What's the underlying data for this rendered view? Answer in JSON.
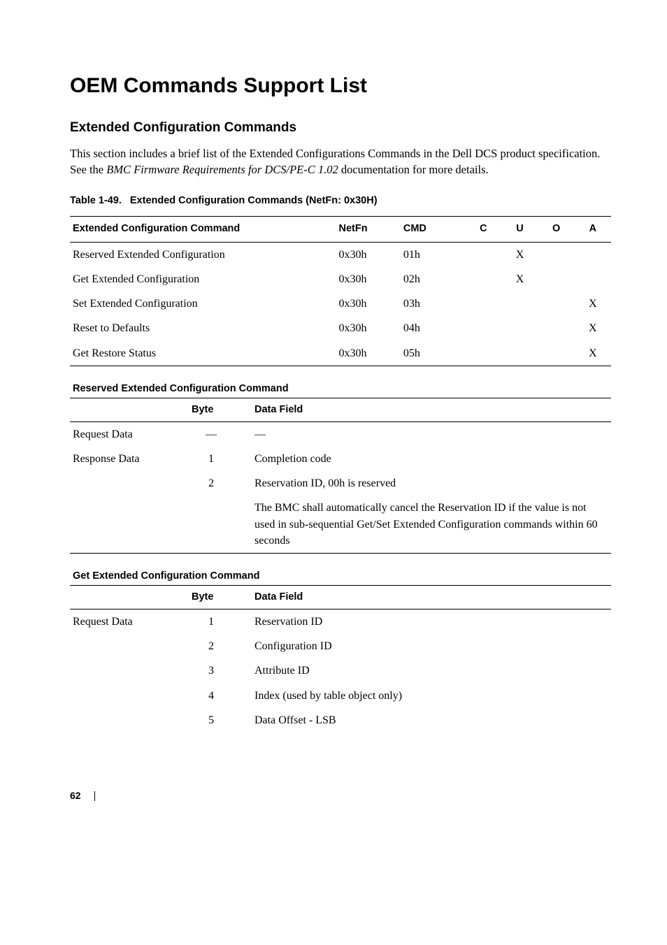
{
  "title": "OEM Commands Support List",
  "section1": {
    "heading": "Extended Configuration Commands",
    "para_part1": "This section includes a brief list of the Extended Configurations Commands in the Dell DCS product specification. See the ",
    "para_italic": "BMC Firmware Requirements for DCS/PE-C 1.02",
    "para_part2": " documentation for more details."
  },
  "table49": {
    "caption_prefix": "Table 1-49.",
    "caption_text": "Extended Configuration Commands (NetFn: 0x30H)",
    "headers": [
      "Extended Configuration Command",
      "NetFn",
      "CMD",
      "C",
      "U",
      "O",
      "A"
    ],
    "rows": [
      [
        "Reserved Extended Configuration",
        "0x30h",
        "01h",
        "",
        "X",
        "",
        ""
      ],
      [
        "Get Extended Configuration",
        "0x30h",
        "02h",
        "",
        "X",
        "",
        ""
      ],
      [
        "Set Extended Configuration",
        "0x30h",
        "03h",
        "",
        "",
        "",
        "X"
      ],
      [
        "Reset to Defaults",
        "0x30h",
        "04h",
        "",
        "",
        "",
        "X"
      ],
      [
        "Get Restore Status",
        "0x30h",
        "05h",
        "",
        "",
        "",
        "X"
      ]
    ]
  },
  "reserved": {
    "title": "Reserved Extended Configuration Command",
    "headers": [
      "",
      "Byte",
      "Data Field"
    ],
    "rows": [
      {
        "c1": "Request Data",
        "c2": "—",
        "c3": "—"
      },
      {
        "c1": "Response Data",
        "c2": "1",
        "c3": "Completion code"
      },
      {
        "c1": "",
        "c2": "2",
        "c3": "Reservation ID, 00h is reserved"
      },
      {
        "c1": "",
        "c2": "",
        "c3": "The BMC shall automatically cancel the Reservation ID if the value is not used in sub-sequential Get/Set Extended Configuration commands within 60 seconds"
      }
    ]
  },
  "getext": {
    "title": "Get Extended Configuration Command",
    "headers": [
      "",
      "Byte",
      "Data Field"
    ],
    "rows": [
      {
        "c1": "Request Data",
        "c2": "1",
        "c3": "Reservation ID"
      },
      {
        "c1": "",
        "c2": "2",
        "c3": "Configuration ID"
      },
      {
        "c1": "",
        "c2": "3",
        "c3": "Attribute ID"
      },
      {
        "c1": "",
        "c2": "4",
        "c3": "Index (used by table object only)"
      },
      {
        "c1": "",
        "c2": "5",
        "c3": "Data Offset - LSB"
      }
    ]
  },
  "footer": {
    "page": "62"
  }
}
